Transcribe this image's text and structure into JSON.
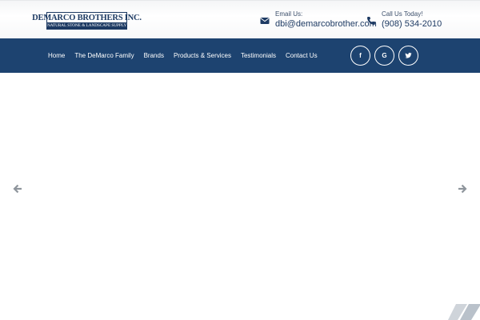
{
  "brand": {
    "logo_main": "DEMARCO BROTHERS INC.",
    "logo_sub": "NATURAL STONE & LANDSCAPE SUPPLY",
    "primary_color": "#1d4370"
  },
  "header": {
    "email_label": "Email Us:",
    "email_value": "dbi@demarcobrother.com",
    "email_icon": "envelope-icon",
    "phone_label": "Call Us Today!",
    "phone_value": "(908) 534-2010",
    "phone_icon": "phone-icon"
  },
  "nav": {
    "items": [
      {
        "label": "Home"
      },
      {
        "label": "The DeMarco Family"
      },
      {
        "label": "Brands"
      },
      {
        "label": "Products & Services"
      },
      {
        "label": "Testimonials"
      },
      {
        "label": "Contact Us"
      }
    ]
  },
  "social": {
    "facebook": "f",
    "google": "G",
    "icons": [
      "facebook-icon",
      "google-icon",
      "twitter-icon"
    ]
  },
  "slider": {
    "prev_icon": "arrow-left-icon",
    "next_icon": "arrow-right-icon"
  }
}
